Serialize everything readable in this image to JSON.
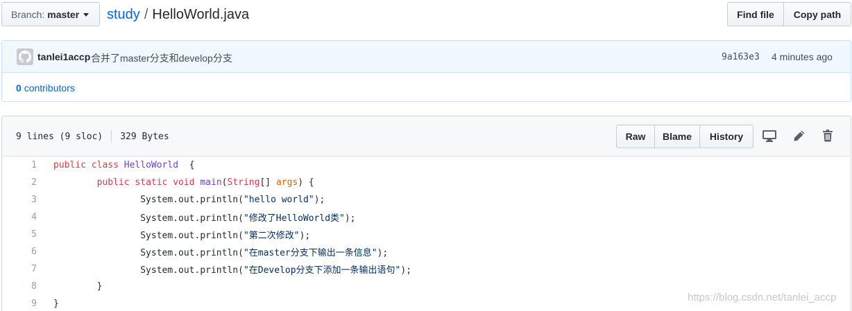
{
  "branch": {
    "label": "Branch:",
    "value": "master"
  },
  "breadcrumb": {
    "repo": "study",
    "separator": "/",
    "file": "HelloWorld.java"
  },
  "top_actions": {
    "find_file": "Find file",
    "copy_path": "Copy path"
  },
  "commit": {
    "author": "tanlei1accp",
    "message": "合并了master分支和develop分支",
    "sha": "9a163e3",
    "time": "4 minutes ago"
  },
  "contributors": {
    "count": "0",
    "label": "contributors"
  },
  "file": {
    "lines_info": "9 lines (9 sloc)",
    "size": "329 Bytes",
    "actions": {
      "raw": "Raw",
      "blame": "Blame",
      "history": "History"
    },
    "icons": [
      "desktop-icon",
      "pencil-icon",
      "trash-icon"
    ]
  },
  "code_lines": [
    {
      "num": "1",
      "parts": [
        [
          "kw",
          "public "
        ],
        [
          "kw",
          "class "
        ],
        [
          "ent",
          "HelloWorld"
        ],
        [
          "",
          "  {"
        ]
      ]
    },
    {
      "num": "2",
      "parts": [
        [
          "",
          "        "
        ],
        [
          "kw",
          "public "
        ],
        [
          "kw",
          "static "
        ],
        [
          "kw",
          "void "
        ],
        [
          "ent",
          "main"
        ],
        [
          "",
          "("
        ],
        [
          "kw",
          "String"
        ],
        [
          "",
          "[] "
        ],
        [
          "prm",
          "args"
        ],
        [
          "",
          ") {"
        ]
      ]
    },
    {
      "num": "3",
      "parts": [
        [
          "",
          "                System.out.println("
        ],
        [
          "str",
          "\"hello world\""
        ],
        [
          "",
          ");"
        ]
      ]
    },
    {
      "num": "4",
      "parts": [
        [
          "",
          "                System.out.println("
        ],
        [
          "str",
          "\"修改了HelloWorld类\""
        ],
        [
          "",
          ");"
        ]
      ]
    },
    {
      "num": "5",
      "parts": [
        [
          "",
          "                System.out.println("
        ],
        [
          "str",
          "\"第二次修改\""
        ],
        [
          "",
          ");"
        ]
      ]
    },
    {
      "num": "6",
      "parts": [
        [
          "",
          "                System.out.println("
        ],
        [
          "str",
          "\"在master分支下输出一条信息\""
        ],
        [
          "",
          ");"
        ]
      ]
    },
    {
      "num": "7",
      "parts": [
        [
          "",
          "                System.out.println("
        ],
        [
          "str",
          "\"在Develop分支下添加一条输出语句\""
        ],
        [
          "",
          ");"
        ]
      ]
    },
    {
      "num": "8",
      "parts": [
        [
          "",
          "        }"
        ]
      ]
    },
    {
      "num": "9",
      "parts": [
        [
          "",
          "}"
        ]
      ]
    }
  ],
  "watermark": "https://blog.csdn.net/tanlei_accp",
  "colors": {
    "link": "#0366d6",
    "keyword": "#d73a49",
    "entity": "#6f42c1",
    "string": "#032f62",
    "param": "#e36209",
    "commit_bg": "#f1f8ff"
  }
}
